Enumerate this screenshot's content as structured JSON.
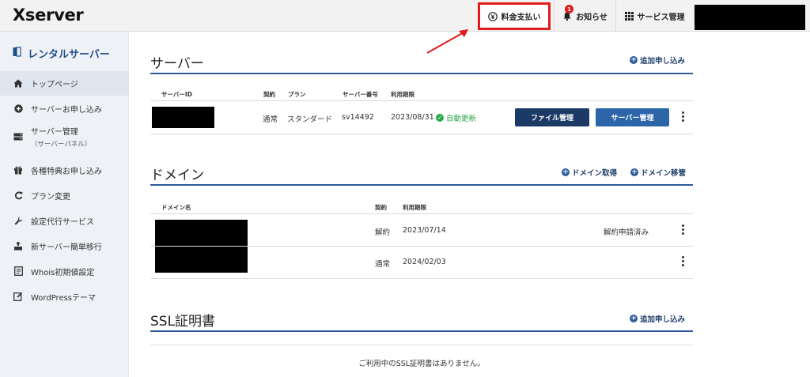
{
  "header": {
    "logo": "Xserver",
    "billing_label": "料金支払い",
    "news_label": "お知らせ",
    "news_badge": "1",
    "service_label": "サービス管理"
  },
  "sidebar": {
    "title": "レンタルサーバー",
    "items": [
      {
        "label": "トップページ",
        "icon": "home-icon"
      },
      {
        "label": "サーバーお申し込み",
        "icon": "plus-circle-icon"
      },
      {
        "label": "サーバー管理",
        "sub": "（サーバーパネル）",
        "icon": "server-icon"
      },
      {
        "label": "各種特典お申し込み",
        "icon": "gift-icon"
      },
      {
        "label": "プラン変更",
        "icon": "refresh-icon"
      },
      {
        "label": "設定代行サービス",
        "icon": "wrench-icon"
      },
      {
        "label": "新サーバー簡単移行",
        "icon": "upload-icon"
      },
      {
        "label": "Whois初期値設定",
        "icon": "document-icon"
      },
      {
        "label": "WordPressテーマ",
        "icon": "edit-icon"
      }
    ]
  },
  "server": {
    "title": "サーバー",
    "add_label": "追加申し込み",
    "headers": [
      "サーバーID",
      "契約",
      "プラン",
      "サーバー番号",
      "利用期限"
    ],
    "row": {
      "contract": "通常",
      "plan": "スタンダード",
      "number": "sv14492",
      "expiry": "2023/08/31",
      "status": "自動更新",
      "file_button": "ファイル管理",
      "server_button": "サーバー管理"
    }
  },
  "domain": {
    "title": "ドメイン",
    "acquire_label": "ドメイン取得",
    "transfer_label": "ドメイン移管",
    "headers": [
      "ドメイン名",
      "契約",
      "利用期限"
    ],
    "rows": [
      {
        "contract": "解約",
        "expiry": "2023/07/14",
        "status": "解約申請済み"
      },
      {
        "contract": "通常",
        "expiry": "2024/02/03",
        "status": ""
      }
    ]
  },
  "ssl": {
    "title": "SSL証明書",
    "add_label": "追加申し込み",
    "empty_message": "ご利用中のSSL証明書はありません。"
  },
  "colors": {
    "accent": "#2c5c9a",
    "highlight": "#e01b1b",
    "success": "#2aa84a"
  }
}
